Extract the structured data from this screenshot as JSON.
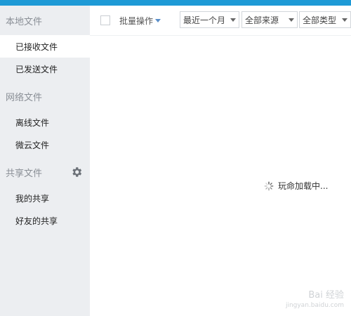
{
  "sidebar": {
    "sections": [
      {
        "title": "本地文件",
        "items": [
          "已接收文件",
          "已发送文件"
        ]
      },
      {
        "title": "网络文件",
        "items": [
          "离线文件",
          "微云文件"
        ]
      },
      {
        "title": "共享文件",
        "items": [
          "我的共享",
          "好友的共享"
        ]
      }
    ],
    "active_item": "已接收文件"
  },
  "toolbar": {
    "batch_label": "批量操作",
    "time_filter": "最近一个月",
    "source_filter": "全部来源",
    "type_filter": "全部类型"
  },
  "content": {
    "loading_text": "玩命加载中..."
  },
  "watermark": {
    "text": "Bai 经验",
    "subtext": "jingyan.baidu.com"
  },
  "colors": {
    "topbar": "#1e9ad6",
    "sidebar_bg": "#eceef1"
  }
}
